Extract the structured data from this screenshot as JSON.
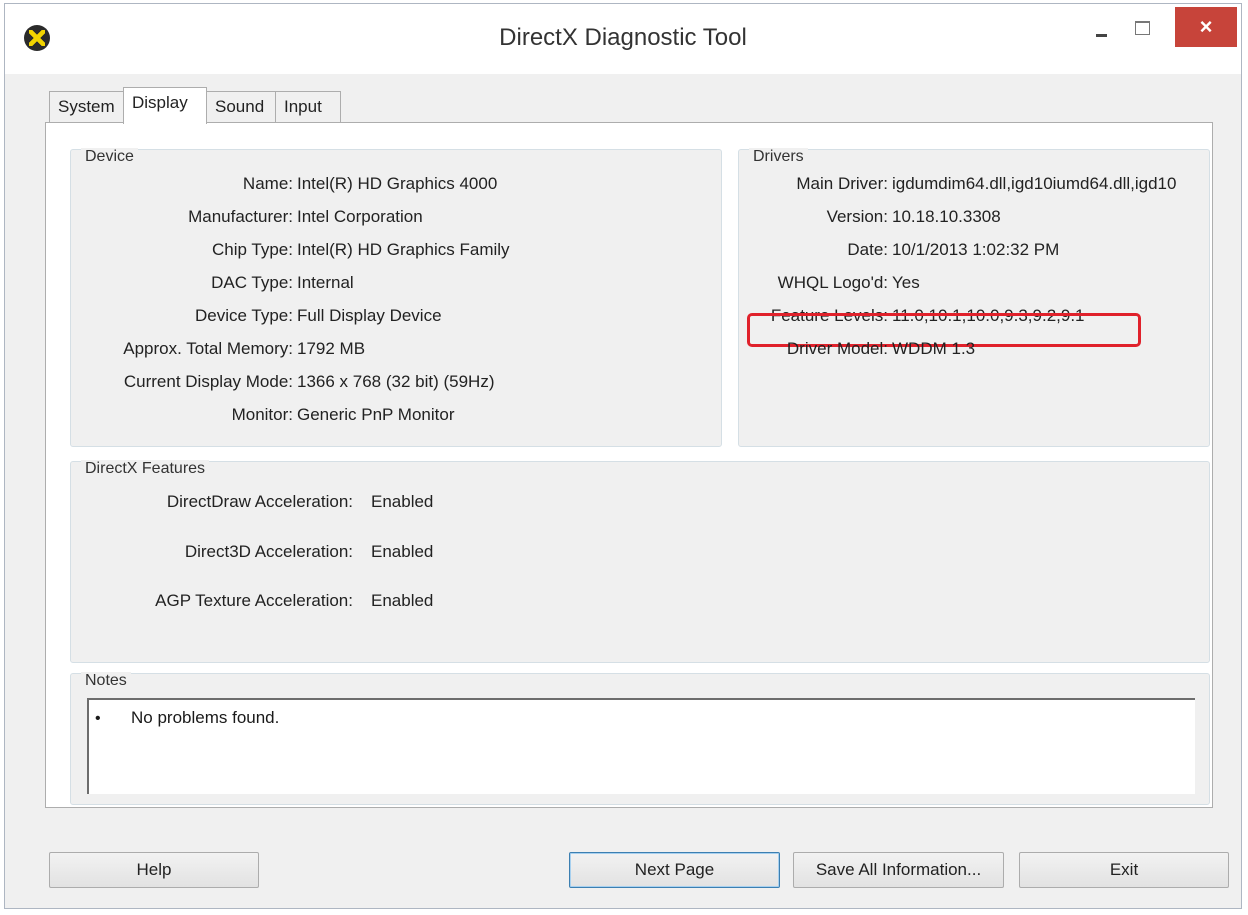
{
  "window": {
    "title": "DirectX Diagnostic Tool",
    "close_glyph": "×"
  },
  "tabs": [
    {
      "label": "System",
      "active": false
    },
    {
      "label": "Display",
      "active": true
    },
    {
      "label": "Sound",
      "active": false
    },
    {
      "label": "Input",
      "active": false
    }
  ],
  "device": {
    "title": "Device",
    "rows": [
      {
        "key": "Name:",
        "value": "Intel(R) HD Graphics 4000"
      },
      {
        "key": "Manufacturer:",
        "value": "Intel Corporation"
      },
      {
        "key": "Chip Type:",
        "value": "Intel(R) HD Graphics Family"
      },
      {
        "key": "DAC Type:",
        "value": "Internal"
      },
      {
        "key": "Device Type:",
        "value": "Full Display Device"
      },
      {
        "key": "Approx. Total Memory:",
        "value": "1792 MB"
      },
      {
        "key": "Current Display Mode:",
        "value": "1366 x 768 (32 bit) (59Hz)"
      },
      {
        "key": "Monitor:",
        "value": "Generic PnP Monitor"
      }
    ]
  },
  "drivers": {
    "title": "Drivers",
    "rows": [
      {
        "key": "Main Driver:",
        "value": "igdumdim64.dll,igd10iumd64.dll,igd10"
      },
      {
        "key": "Version:",
        "value": "10.18.10.3308"
      },
      {
        "key": "Date:",
        "value": "10/1/2013 1:02:32 PM"
      },
      {
        "key": "WHQL Logo'd:",
        "value": "Yes"
      },
      {
        "key": "Feature Levels:",
        "value": "11.0,10.1,10.0,9.3,9.2,9.1"
      },
      {
        "key": "Driver Model:",
        "value": "WDDM 1.3"
      }
    ],
    "highlight_color": "#e0212b"
  },
  "features": {
    "title": "DirectX Features",
    "rows": [
      {
        "key": "DirectDraw Acceleration:",
        "value": "Enabled"
      },
      {
        "key": "Direct3D Acceleration:",
        "value": "Enabled"
      },
      {
        "key": "AGP Texture Acceleration:",
        "value": "Enabled"
      }
    ]
  },
  "notes": {
    "title": "Notes",
    "bullet": "•",
    "items": [
      "No problems found."
    ]
  },
  "buttons": {
    "help": "Help",
    "next_page": "Next Page",
    "save_all": "Save All Information...",
    "exit": "Exit"
  }
}
